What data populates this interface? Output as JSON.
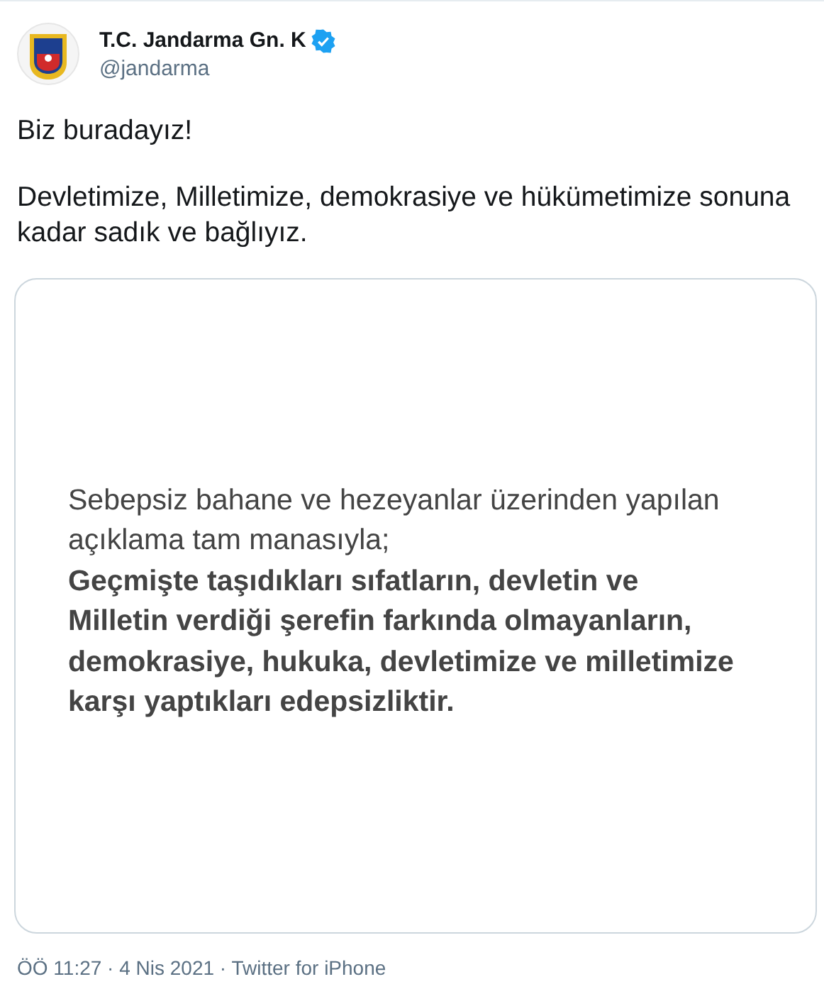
{
  "author": {
    "name": "T.C. Jandarma Gn. K",
    "handle": "@jandarma",
    "verified": true
  },
  "tweet_text": [
    "Biz buradayız!",
    "Devletimize, Milletimize, demokrasiye ve hükümetimize sonuna kadar sadık ve bağlıyız."
  ],
  "media": {
    "intro": "Sebepsiz bahane ve hezeyanlar üzerinden yapılan açıklama tam manasıyla;",
    "statement": "Geçmişte taşıdıkları sıfatların, devletin ve Milletin verdiği şerefin farkında olmayanların, demokrasiye, hukuka, devletimize ve milletimize karşı yaptıkları edepsizliktir."
  },
  "meta": "ÖÖ 11:27 · 4 Nis 2021 · Twitter for iPhone"
}
